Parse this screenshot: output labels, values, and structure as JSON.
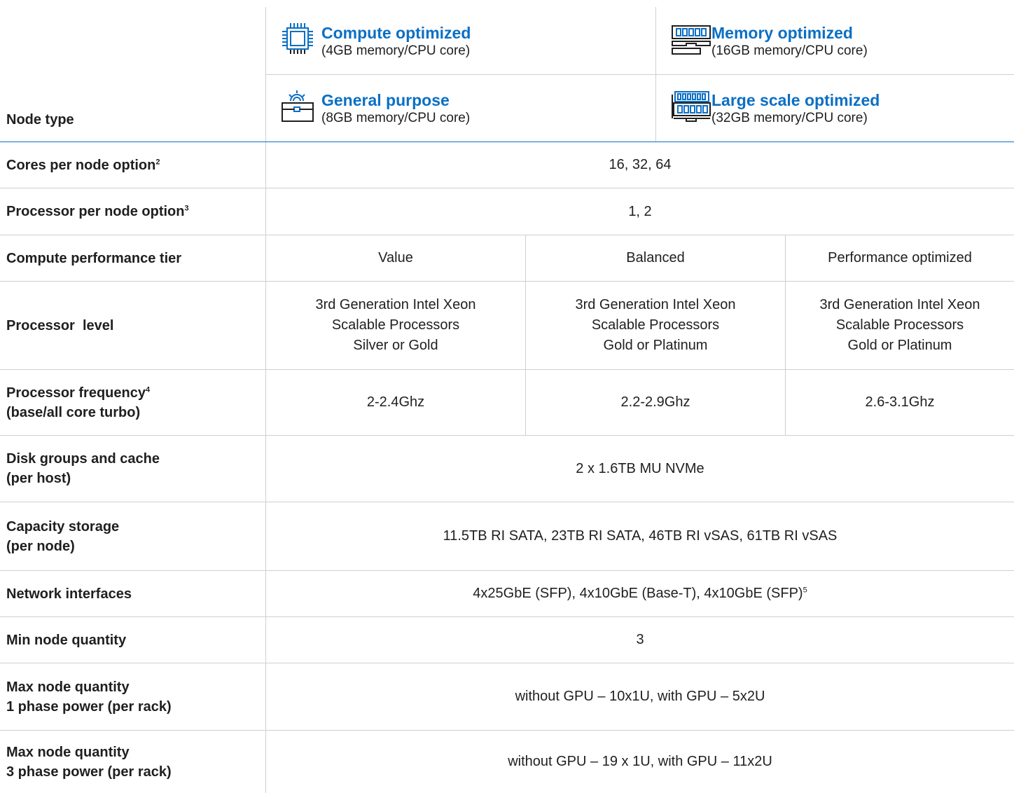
{
  "header": {
    "row_label": "Node type",
    "node_types": [
      {
        "title": "Compute optimized",
        "subtitle": "(4GB memory/CPU core)",
        "icon": "cpu-chip-icon"
      },
      {
        "title": "Memory optimized",
        "subtitle": "(16GB memory/CPU core)",
        "icon": "memory-module-icon"
      },
      {
        "title": "General purpose",
        "subtitle": "(8GB memory/CPU core)",
        "icon": "toolbox-gear-icon"
      },
      {
        "title": "Large scale optimized",
        "subtitle": "(32GB memory/CPU core)",
        "icon": "stacked-memory-icon"
      }
    ]
  },
  "rows": {
    "cores": {
      "label": "Cores per node option",
      "sup": "2",
      "value": "16, 32, 64"
    },
    "processor": {
      "label": "Processor per node option",
      "sup": "3",
      "value": "1, 2"
    },
    "tier": {
      "label": "Compute performance tier",
      "values": [
        "Value",
        "Balanced",
        "Performance optimized"
      ]
    },
    "level": {
      "label": "Processor  level",
      "cols": [
        [
          "3rd Generation Intel Xeon",
          "Scalable Processors",
          "Silver or Gold"
        ],
        [
          "3rd Generation Intel Xeon",
          "Scalable Processors",
          "Gold or Platinum"
        ],
        [
          "3rd Generation Intel Xeon",
          "Scalable Processors",
          "Gold or Platinum"
        ]
      ]
    },
    "frequency": {
      "label_line1": "Processor frequency",
      "sup": "4",
      "label_line2": "(base/all core turbo)",
      "values": [
        "2-2.4Ghz",
        "2.2-2.9Ghz",
        "2.6-3.1Ghz"
      ]
    },
    "disk": {
      "label_line1": "Disk groups and cache",
      "label_line2": "(per host)",
      "value": "2 x 1.6TB MU NVMe"
    },
    "capacity": {
      "label_line1": "Capacity storage",
      "label_line2": "(per node)",
      "value": "11.5TB RI SATA, 23TB RI SATA, 46TB RI vSAS, 61TB RI vSAS"
    },
    "network": {
      "label": "Network interfaces",
      "value": "4x25GbE (SFP), 4x10GbE (Base-T), 4x10GbE (SFP)",
      "sup": "5"
    },
    "min_nodes": {
      "label": "Min node quantity",
      "value": "3"
    },
    "max_1phase": {
      "label_line1": "Max node quantity",
      "label_line2": "1 phase power (per rack)",
      "value": "without GPU – 10x1U, with GPU – 5x2U"
    },
    "max_3phase": {
      "label_line1": "Max node quantity",
      "label_line2": "3 phase power (per rack)",
      "value": "without GPU – 19 x 1U, with GPU – 11x2U"
    }
  },
  "colors": {
    "accent": "#0b6fc4",
    "rule": "#cfcfcf",
    "text": "#1f1f1f"
  }
}
